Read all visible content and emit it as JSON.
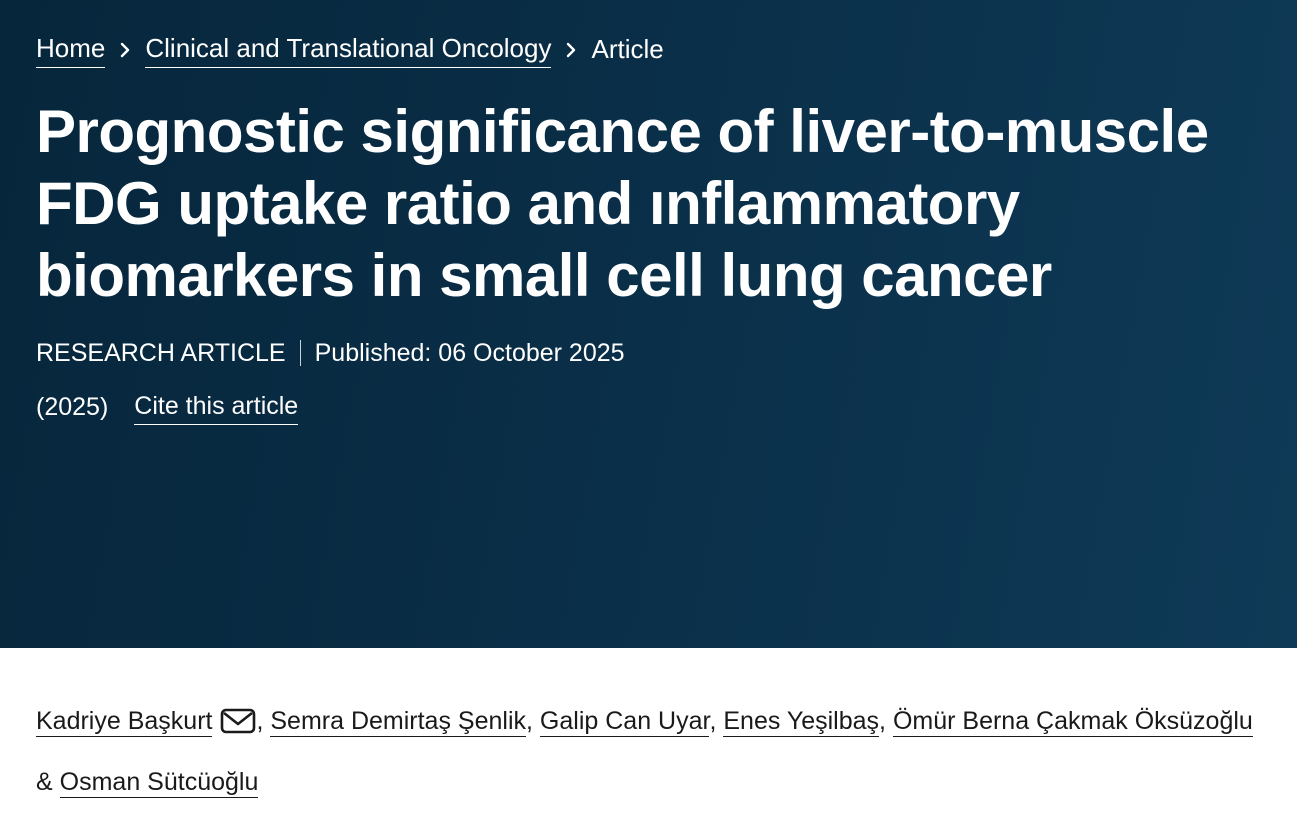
{
  "breadcrumb": {
    "home": "Home",
    "journal": "Clinical and Translational Oncology",
    "current": "Article",
    "separator_icon": "chevron-right-icon"
  },
  "article": {
    "title": "Prognostic significance of liver-to-muscle FDG uptake ratio and ınflammatory biomarkers in small cell lung cancer",
    "type": "RESEARCH ARTICLE",
    "published": "Published: 06 October 2025",
    "year": "(2025)",
    "cite_label": "Cite this article"
  },
  "authors": {
    "list": [
      "Kadriye Başkurt",
      "Semra Demirtaş Şenlik",
      "Galip Can Uyar",
      "Enes Yeşilbaş",
      "Ömür Berna Çakmak Öksüzoğlu",
      "Osman Sütcüoğlu"
    ],
    "comma": ",",
    "ampersand": "&",
    "mail_icon": "mail-icon"
  },
  "colors": {
    "hero_background": "#0a2e47",
    "hero_text": "#ffffff",
    "body_text": "#1a1a1a"
  }
}
